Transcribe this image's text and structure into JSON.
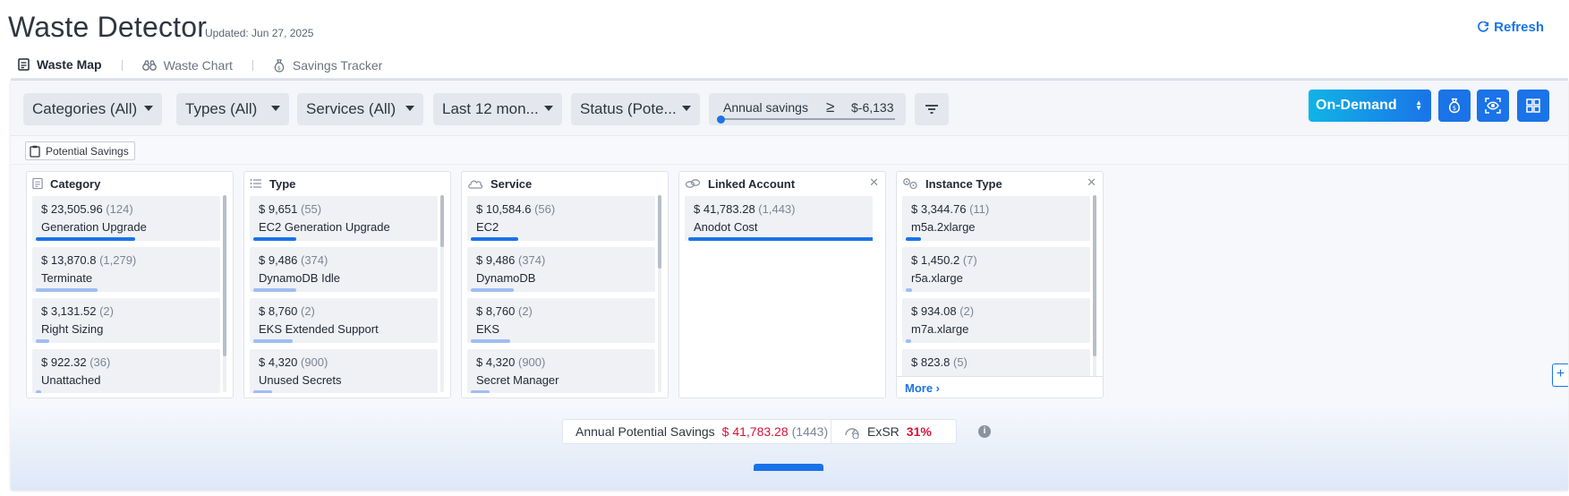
{
  "header": {
    "title": "Waste Detector",
    "updated": "Updated: Jun 27, 2025",
    "refresh_label": "Refresh"
  },
  "tabs": [
    {
      "label": "Waste Map",
      "active": true,
      "icon": "document-icon"
    },
    {
      "label": "Waste Chart",
      "active": false,
      "icon": "binoculars-icon"
    },
    {
      "label": "Savings Tracker",
      "active": false,
      "icon": "money-bag-icon"
    }
  ],
  "filters": {
    "categories": "Categories (All)",
    "types": "Types (All)",
    "services": "Services (All)",
    "period": "Last 12 mon...",
    "status": "Status (Pote..."
  },
  "slider": {
    "label": "Annual savings",
    "operator": "≥",
    "value": "$-6,133"
  },
  "pricing": {
    "selected": "On-Demand"
  },
  "chip": {
    "label": "Potential Savings"
  },
  "colors": {
    "accent": "#1a73e8",
    "bar_strong": "#1a73e8",
    "bar_light": "#9fbdf2",
    "negative": "#d6123a"
  },
  "cards": [
    {
      "title": "Category",
      "icon": "document-icon",
      "items": [
        {
          "amount": "$ 23,505.96",
          "count": "(124)",
          "name": "Generation Upgrade",
          "fraction": 0.53
        },
        {
          "amount": "$ 13,870.8",
          "count": "(1,279)",
          "name": "Terminate",
          "fraction": 0.33
        },
        {
          "amount": "$ 3,131.52",
          "count": "(2)",
          "name": "Right Sizing",
          "fraction": 0.07
        },
        {
          "amount": "$ 922.32",
          "count": "(36)",
          "name": "Unattached",
          "fraction": 0.02
        }
      ]
    },
    {
      "title": "Type",
      "icon": "list-icon",
      "items": [
        {
          "amount": "$ 9,651",
          "count": "(55)",
          "name": "EC2 Generation Upgrade",
          "fraction": 0.23
        },
        {
          "amount": "$ 9,486",
          "count": "(374)",
          "name": "DynamoDB Idle",
          "fraction": 0.23
        },
        {
          "amount": "$ 8,760",
          "count": "(2)",
          "name": "EKS Extended Support",
          "fraction": 0.21
        },
        {
          "amount": "$ 4,320",
          "count": "(900)",
          "name": "Unused Secrets",
          "fraction": 0.1
        }
      ]
    },
    {
      "title": "Service",
      "icon": "cloud-icon",
      "items": [
        {
          "amount": "$ 10,584.6",
          "count": "(56)",
          "name": "EC2",
          "fraction": 0.25
        },
        {
          "amount": "$ 9,486",
          "count": "(374)",
          "name": "DynamoDB",
          "fraction": 0.23
        },
        {
          "amount": "$ 8,760",
          "count": "(2)",
          "name": "EKS",
          "fraction": 0.21
        },
        {
          "amount": "$ 4,320",
          "count": "(900)",
          "name": "Secret Manager",
          "fraction": 0.1
        }
      ]
    },
    {
      "title": "Linked Account",
      "icon": "link-icon",
      "items": [
        {
          "amount": "$ 41,783.28",
          "count": "(1,443)",
          "name": "Anodot Cost",
          "fraction": 1.0
        }
      ]
    },
    {
      "title": "Instance Type",
      "icon": "gears-icon",
      "more_label": "More",
      "items": [
        {
          "amount": "$ 3,344.76",
          "count": "(11)",
          "name": "m5a.2xlarge",
          "fraction": 0.08
        },
        {
          "amount": "$ 1,450.2",
          "count": "(7)",
          "name": "r5a.xlarge",
          "fraction": 0.035
        },
        {
          "amount": "$ 934.08",
          "count": "(2)",
          "name": "m7a.xlarge",
          "fraction": 0.022
        },
        {
          "amount": "$ 823.8",
          "count": "(5)",
          "name": "",
          "fraction": 0.02
        }
      ]
    }
  ],
  "summary": {
    "label": "Annual Potential Savings",
    "amount": "$ 41,783.28",
    "count": "(1443)",
    "exsr_label": "ExSR",
    "exsr_value": "31%"
  }
}
